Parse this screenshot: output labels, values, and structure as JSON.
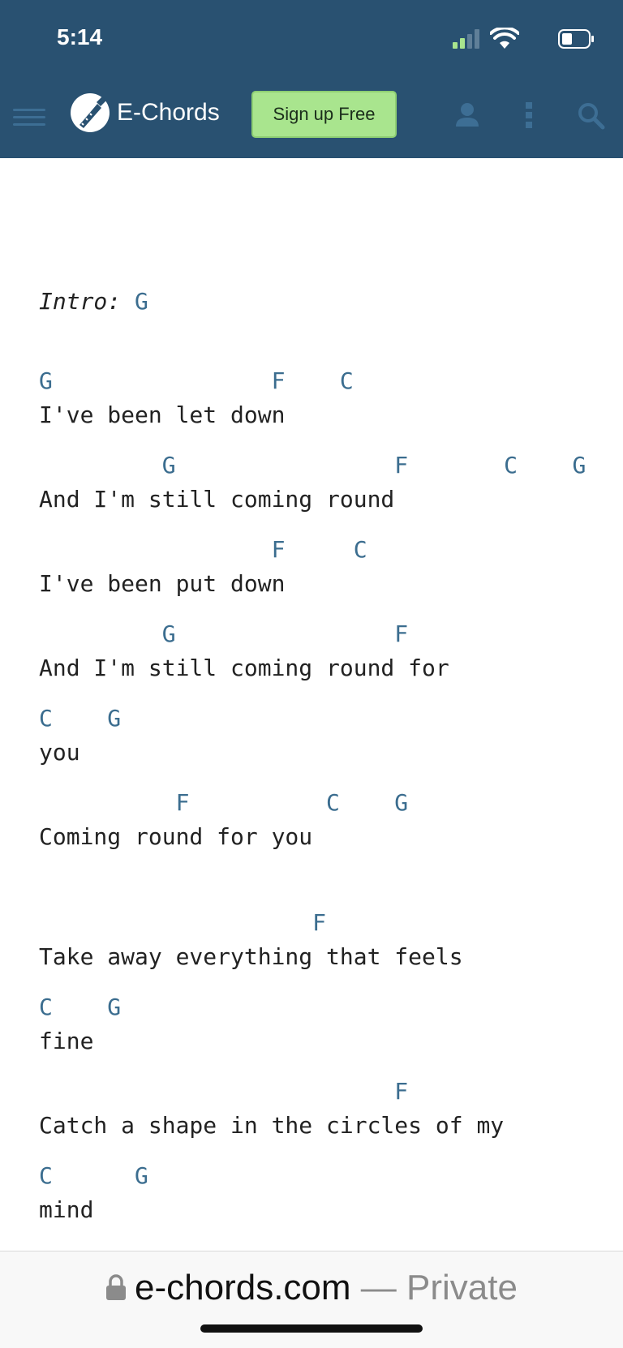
{
  "status_bar": {
    "time": "5:14"
  },
  "header": {
    "brand": "E-Chords",
    "signup_label": "Sign up Free",
    "colors": {
      "background": "#295171",
      "signup_bg": "#a9e58e",
      "chord": "#3b6d8f"
    },
    "icons": [
      "menu-icon",
      "guitar-logo-icon",
      "user-icon",
      "more-vertical-icon",
      "search-icon"
    ]
  },
  "song": {
    "intro_label": "Intro:",
    "intro_chord": "G",
    "lines": [
      {
        "chords": "G                F    C",
        "lyrics": "I've been let down"
      },
      {
        "chords": "         G                F       C    G",
        "lyrics": "And I'm still coming round"
      },
      {
        "chords": "                 F     C",
        "lyrics": "I've been put down"
      },
      {
        "chords": "         G                F",
        "lyrics": "And I'm still coming round for"
      },
      {
        "chords": "C    G",
        "lyrics": "you"
      },
      {
        "chords": "          F          C    G",
        "lyrics": "Coming round for you"
      },
      {
        "chords": "                    F",
        "lyrics": "Take away everything that feels"
      },
      {
        "chords": "C    G",
        "lyrics": "fine"
      },
      {
        "chords": "                          F",
        "lyrics": "Catch a shape in the circles of my"
      },
      {
        "chords": "C      G",
        "lyrics": "mind"
      }
    ]
  },
  "url_bar": {
    "domain": "e-chords.com",
    "separator": " — ",
    "mode": "Private"
  }
}
